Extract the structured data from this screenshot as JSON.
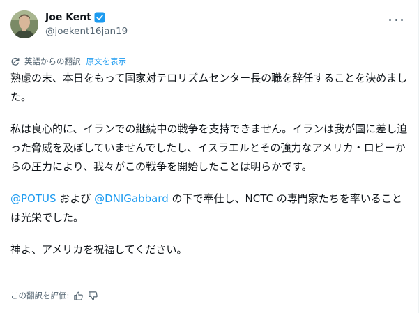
{
  "author": {
    "display_name": "Joe Kent",
    "handle": "@joekent16jan19",
    "verified_icon": "verified-badge-icon"
  },
  "translation": {
    "translated_from": "英語からの翻訳",
    "show_original": "原文を表示"
  },
  "tweet": {
    "para1": "熟慮の末、本日をもって国家対テロリズムセンター長の職を辞任することを決めました。",
    "para2": "私は良心的に、イランでの継続中の戦争を支持できません。イランは我が国に差し迫った脅威を及ぼしていませんでしたし、イスラエルとその強力なアメリカ・ロビーからの圧力により、我々がこの戦争を開始したことは明らかです。",
    "para3_mention1": "@POTUS",
    "para3_mid": " および ",
    "para3_mention2": "@DNIGabbard",
    "para3_rest": " の下で奉仕し、NCTC の専門家たちを率いることは光栄でした。",
    "para4": "神よ、アメリカを祝福してください。"
  },
  "rating": {
    "label": "この翻訳を評価:"
  },
  "colors": {
    "accent": "#1d9bf0",
    "text": "#0f1419",
    "secondary": "#536471"
  }
}
